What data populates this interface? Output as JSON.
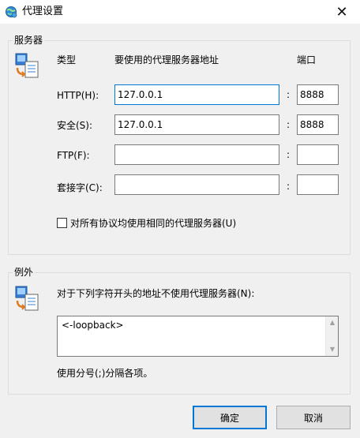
{
  "window": {
    "title": "代理设置",
    "close_glyph": "✕"
  },
  "servers": {
    "group_label": "服务器",
    "col_type": "类型",
    "col_address": "要使用的代理服务器地址",
    "col_port": "端口",
    "rows": [
      {
        "label": "HTTP(H):",
        "address": "127.0.0.1",
        "port": "8888"
      },
      {
        "label": "安全(S):",
        "address": "127.0.0.1",
        "port": "8888"
      },
      {
        "label": "FTP(F):",
        "address": "",
        "port": ""
      },
      {
        "label": "套接字(C):",
        "address": "",
        "port": ""
      }
    ],
    "colon": ":",
    "same_proxy_label": "对所有协议均使用相同的代理服务器(U)",
    "same_proxy_checked": false
  },
  "exceptions": {
    "group_label": "例外",
    "description": "对于下列字符开头的地址不使用代理服务器(N):",
    "value": "<-loopback>",
    "hint": "使用分号(;)分隔各项。"
  },
  "buttons": {
    "ok": "确定",
    "cancel": "取消"
  },
  "colors": {
    "accent": "#0078d7",
    "border": "#7a7a7a",
    "background": "#f0f0f0"
  },
  "icons": {
    "title": "network-globe-icon",
    "servers": "proxy-server-icon",
    "exceptions": "proxy-server-icon"
  }
}
